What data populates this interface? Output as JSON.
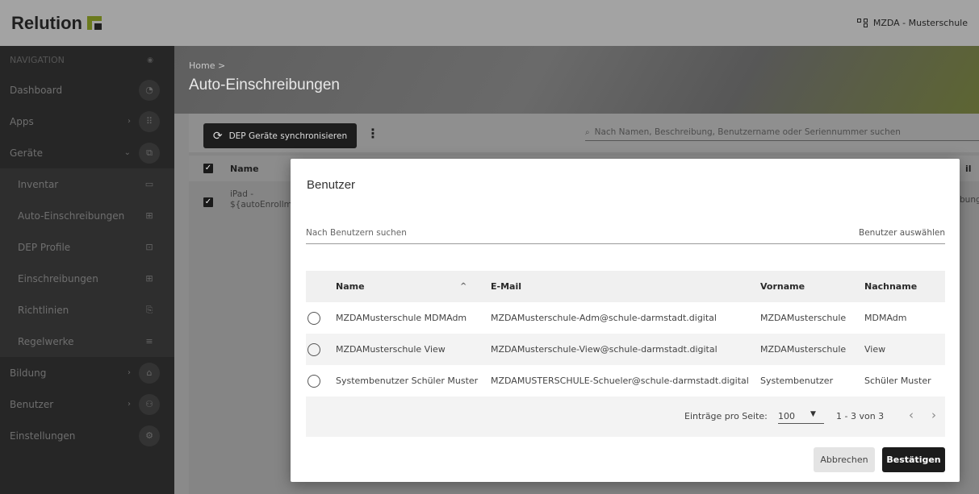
{
  "app": {
    "brand": "Relution",
    "tenant": "MZDA - Musterschule"
  },
  "sidebar": {
    "header": "NAVIGATION",
    "items": [
      {
        "label": "Dashboard",
        "icon": "gauge-icon",
        "glyph": "◔"
      },
      {
        "label": "Apps",
        "icon": "grid-icon",
        "glyph": "⠿",
        "chevron": "›"
      },
      {
        "label": "Geräte",
        "icon": "devices-icon",
        "glyph": "⧉",
        "chevron": "⌄"
      },
      {
        "label": "Inventar",
        "icon": "inventory-icon",
        "glyph": "▭"
      },
      {
        "label": "Auto-Einschreibungen",
        "icon": "auto-enroll-icon",
        "glyph": "⊞"
      },
      {
        "label": "DEP Profile",
        "icon": "dep-profile-icon",
        "glyph": "⊡"
      },
      {
        "label": "Einschreibungen",
        "icon": "enroll-icon",
        "glyph": "⊞"
      },
      {
        "label": "Richtlinien",
        "icon": "policy-icon",
        "glyph": "⎘"
      },
      {
        "label": "Regelwerke",
        "icon": "rules-icon",
        "glyph": "≡"
      },
      {
        "label": "Bildung",
        "icon": "education-icon",
        "glyph": "⌂",
        "chevron": "›"
      },
      {
        "label": "Benutzer",
        "icon": "users-icon",
        "glyph": "⚇",
        "chevron": "›"
      },
      {
        "label": "Einstellungen",
        "icon": "settings-icon",
        "glyph": "⚙"
      }
    ]
  },
  "page": {
    "breadcrumb": "Home >",
    "title": "Auto-Einschreibungen",
    "sync_button": "DEP Geräte synchronisieren",
    "search_placeholder": "Nach Namen, Beschreibung, Benutzername oder Seriennummer suchen",
    "table": {
      "name_header": "Name",
      "row1_line1": "iPad -",
      "row1_line2": "${autoEnrollm",
      "right_header": "il",
      "right_cell": "bung"
    }
  },
  "modal": {
    "title": "Benutzer",
    "search_placeholder": "Nach Benutzern suchen",
    "search_right": "Benutzer auswählen",
    "columns": {
      "name": "Name",
      "email": "E-Mail",
      "first": "Vorname",
      "last": "Nachname",
      "sort_indicator": "^"
    },
    "rows": [
      {
        "name": "MZDAMusterschule MDMAdm",
        "email": "MZDAMusterschule-Adm@schule-darmstadt.digital",
        "first": "MZDAMusterschule",
        "last": "MDMAdm"
      },
      {
        "name": "MZDAMusterschule View",
        "email": "MZDAMusterschule-View@schule-darmstadt.digital",
        "first": "MZDAMusterschule",
        "last": "View"
      },
      {
        "name": "Systembenutzer Schüler Muster",
        "email": "MZDAMUSTERSCHULE-Schueler@schule-darmstadt.digital",
        "first": "Systembenutzer",
        "last": "Schüler Muster"
      }
    ],
    "pager": {
      "label": "Einträge pro Seite:",
      "per_page": "100",
      "range": "1 - 3 von 3",
      "prev": "‹",
      "next": "›"
    },
    "cancel": "Abbrechen",
    "confirm": "Bestätigen"
  },
  "colors": {
    "overlay_dark": "#262626",
    "brand_green": "#6b7a1d",
    "confirm_bg": "#1c1c1c"
  }
}
